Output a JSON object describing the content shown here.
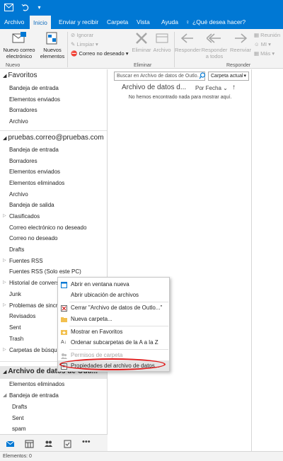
{
  "menu": {
    "tabs": [
      "Archivo",
      "Inicio",
      "Enviar y recibir",
      "Carpeta",
      "Vista",
      "Ayuda"
    ],
    "tell_me": "¿Qué desea hacer?"
  },
  "ribbon": {
    "new_email": "Nuevo correo electrónico",
    "new_items": "Nuevos elementos",
    "ignore": "Ignorar",
    "clean": "Limpiar",
    "junk": "Correo no deseado",
    "delete": "Eliminar",
    "archive": "Archivo",
    "delete_group": "Eliminar",
    "reply": "Responder",
    "reply_all": "Responder a todos",
    "forward": "Reenviar",
    "meeting": "Reunión",
    "im": "MI",
    "more": "Más",
    "respond_group": "Responder",
    "new_group": "Nuevo"
  },
  "folders": {
    "favorites_title": "Favoritos",
    "favorites": [
      "Bandeja de entrada",
      "Elementos enviados",
      "Borradores",
      "Archivo"
    ],
    "account_title": "pruebas.correo@pruebas.com",
    "account_items": [
      "Bandeja de entrada",
      "Borradores",
      "Elementos enviados",
      "Elementos eliminados",
      "Archivo",
      "Bandeja de salida",
      "Clasificados",
      "Correo electrónico no deseado",
      "Correo no deseado",
      "Drafts",
      "Fuentes RSS",
      "Fuentes RSS (Solo este PC)",
      "Historial de convers",
      "Junk",
      "Problemas de sincro",
      "Revisados",
      "Sent",
      "Trash",
      "Carpetas de búsque"
    ],
    "datafile_title": "Archivo de datos de Outl...",
    "datafile_items": [
      "Elementos eliminados",
      "Bandeja de entrada"
    ],
    "datafile_sub": [
      "Drafts",
      "Sent",
      "spam"
    ]
  },
  "messages": {
    "search_placeholder": "Buscar en Archivo de datos de Outlo...",
    "scope": "Carpeta actual",
    "header": "Archivo de datos d...",
    "sort": "Por Fecha",
    "empty": "No hemos encontrado nada para mostrar aquí."
  },
  "context_menu": {
    "items": [
      "Abrir en ventana nueva",
      "Abrir ubicación de archivos",
      "Cerrar \"Archivo de datos de Outlo...\"",
      "Nueva carpeta...",
      "Mostrar en Favoritos",
      "Ordenar subcarpetas de la A a la Z",
      "Permisos de carpeta",
      "Propiedades del archivo de datos..."
    ]
  },
  "status": {
    "items": "Elementos: 0"
  },
  "colors": {
    "accent": "#0078d4",
    "highlight_circle": "#e01a1a"
  }
}
